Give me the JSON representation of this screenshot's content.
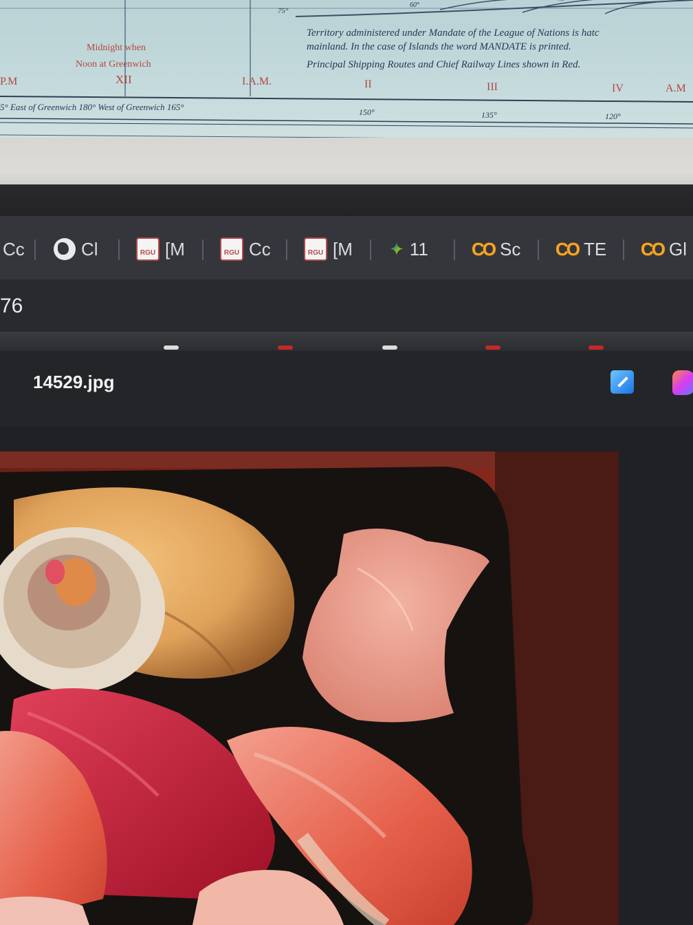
{
  "map": {
    "degree_top": "75°",
    "degree_top_right": "60°",
    "legend_line1": "Territory administered under Mandate of the League of Nations is hatc",
    "legend_line2": "mainland. In the case of Islands the word MANDATE is printed.",
    "legend_line3": "Principal Shipping Routes and Chief Railway Lines shown in Red.",
    "midnight_line1": "Midnight when",
    "midnight_line2": "Noon at Greenwich",
    "hours": [
      "P.M",
      "XII",
      "I.A.M.",
      "II",
      "III",
      "IV",
      "A.M"
    ],
    "longitude_left": "5° East of Greenwich  180° West of Greenwich  165°",
    "longitudes": [
      "150°",
      "135°",
      "120°"
    ]
  },
  "browser": {
    "bookmarks": [
      {
        "icon": "generic",
        "label": "Cc"
      },
      {
        "icon": "globe-icon",
        "label": "Cl"
      },
      {
        "icon": "rgu-icon",
        "label": "[M"
      },
      {
        "icon": "rgu-icon",
        "label": "Cc"
      },
      {
        "icon": "rgu-icon",
        "label": "[M"
      },
      {
        "icon": "spark-icon",
        "label": "11"
      },
      {
        "icon": "colab-icon",
        "label": "Sc"
      },
      {
        "icon": "colab-icon",
        "label": "TE"
      },
      {
        "icon": "colab-icon",
        "label": "Gl"
      }
    ],
    "url_fragment": "76"
  },
  "viewer": {
    "file_name": "14529.jpg"
  },
  "colors": {
    "bookmark_bar": "#34363b",
    "url_bar": "#292a2d",
    "viewer_bg": "#202124",
    "colab_orange": "#f5a623",
    "rgu_red": "#b54a4a"
  }
}
